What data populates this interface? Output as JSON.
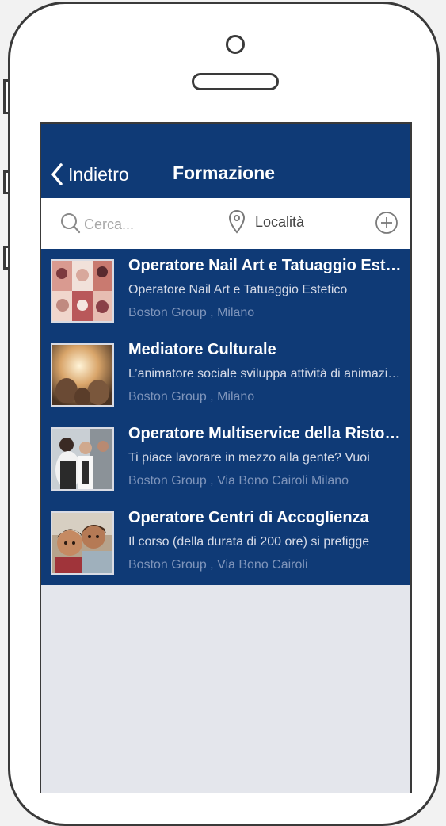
{
  "navbar": {
    "back_label": "Indietro",
    "title": "Formazione"
  },
  "search": {
    "placeholder": "Cerca...",
    "location_label": "Località"
  },
  "colors": {
    "navbar": "#0f3a76",
    "list_bg": "#0f3a76",
    "screen_bg": "#e4e6ec"
  },
  "courses": [
    {
      "title": "Operatore Nail Art e Tatuaggio Estetico",
      "description": "Operatore Nail Art e Tatuaggio Estetico",
      "location": "Boston Group , Milano",
      "thumb": "nail-art-photo"
    },
    {
      "title": "Mediatore Culturale",
      "description": "L’animatore sociale sviluppa attività di animazione",
      "location": "Boston Group , Milano",
      "thumb": "people-celebrating-photo"
    },
    {
      "title": "Operatore Multiservice della Ristorazione",
      "description": "Ti piace lavorare in mezzo alla gente? Vuoi",
      "location": "Boston Group , Via Bono Cairoli Milano",
      "thumb": "restaurant-staff-photo"
    },
    {
      "title": "Operatore Centri di Accoglienza",
      "description": "Il corso (della durata di 200 ore) si prefigge",
      "location": "Boston Group , Via Bono Cairoli",
      "thumb": "children-photo"
    }
  ]
}
